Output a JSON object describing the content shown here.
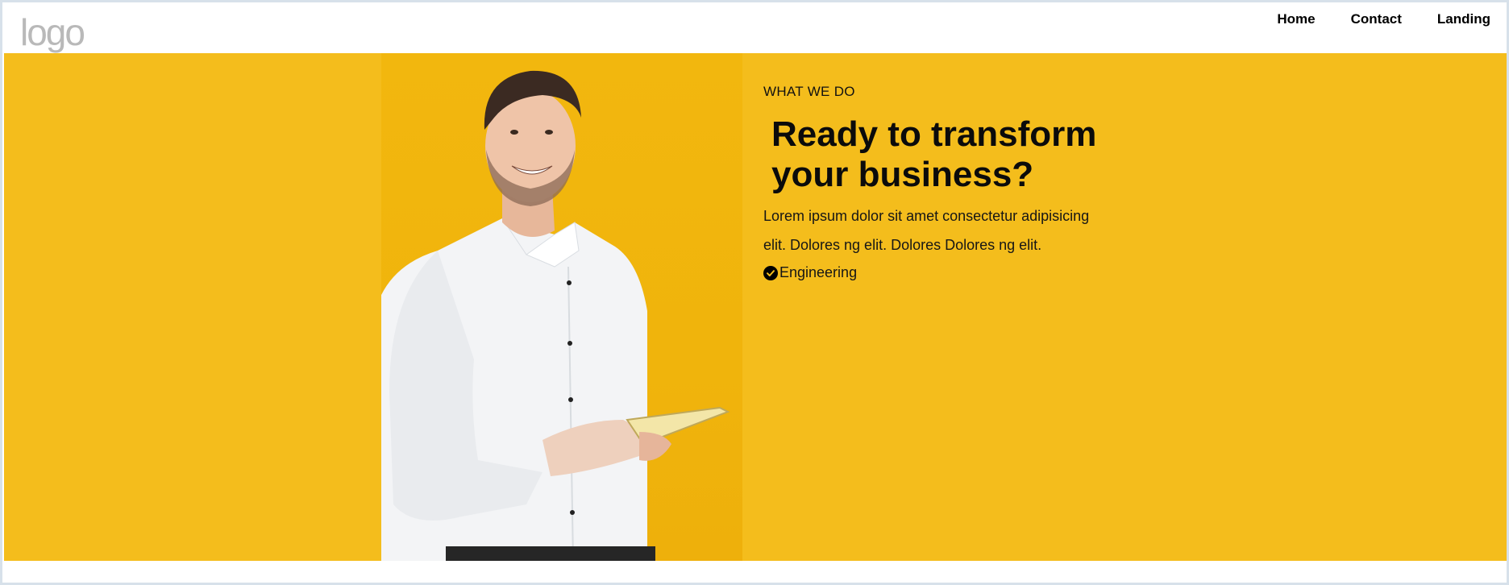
{
  "header": {
    "logo_text": "logo",
    "nav": [
      {
        "label": "Home"
      },
      {
        "label": "Contact"
      },
      {
        "label": "Landing"
      }
    ]
  },
  "hero": {
    "eyebrow": "WHAT WE DO",
    "headline": "Ready to transform your business?",
    "body": "Lorem ipsum dolor sit amet consectetur adipisicing elit. Dolores ng elit. Dolores Dolores ng elit.",
    "features": [
      {
        "icon": "check-circle-icon",
        "label": "Engineering"
      }
    ],
    "photo_alt": "smiling man in white shirt holding tablet"
  },
  "colors": {
    "hero_background": "#f4bd1c",
    "logo": "#b9b9b9",
    "frame_border": "#d7e1ea"
  }
}
